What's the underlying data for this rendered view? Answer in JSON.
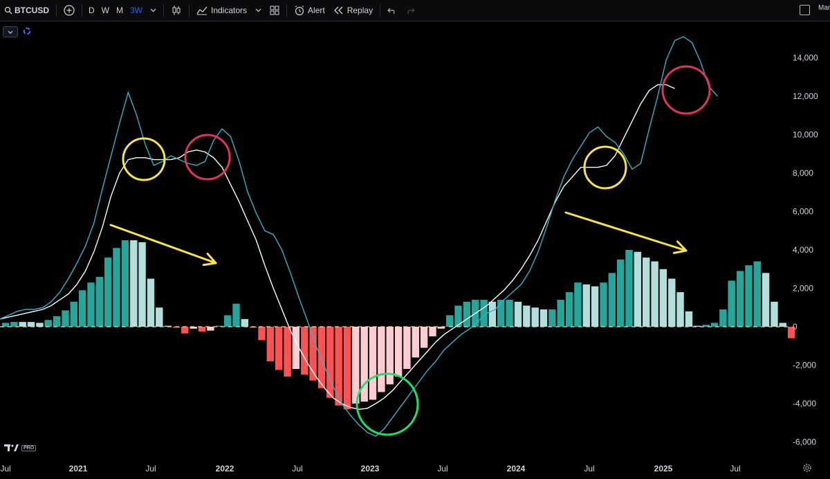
{
  "toolbar": {
    "symbol": "BTCUSD",
    "timeframes": [
      "D",
      "W",
      "M",
      "3W"
    ],
    "active_timeframe": "3W",
    "indicators_label": "Indicators",
    "alert_label": "Alert",
    "replay_label": "Replay",
    "right_label": "Mar"
  },
  "watermark": {
    "pro_label": "PRO"
  },
  "colors": {
    "macd_line": "#33b3c7",
    "signal_line": "#ffffff",
    "hist_pos_grow": "#26a69a",
    "hist_pos_fall": "#b2dfdb",
    "hist_neg_grow": "#ff5252",
    "hist_neg_fall": "#ffcdd2",
    "zero_line": "#f5e08a",
    "annotation_yellow": "#f7e34b",
    "annotation_red": "#e0335f",
    "annotation_green": "#1ee06a"
  },
  "chart_data": {
    "type": "bar",
    "x_ticks": [
      "Jul",
      "2021",
      "Jul",
      "2022",
      "Jul",
      "2023",
      "Jul",
      "2024",
      "Jul",
      "2025",
      "Jul"
    ],
    "y_ticks": [
      "14,000",
      "12,000",
      "10,000",
      "8,000",
      "6,000",
      "4,000",
      "2,000",
      "0",
      "-2,000",
      "-4,000",
      "-6,000"
    ],
    "ylim": [
      -6500,
      15500
    ],
    "histogram": [
      {
        "value": 200,
        "state": "grow"
      },
      {
        "value": 250,
        "state": "grow"
      },
      {
        "value": 250,
        "state": "fall"
      },
      {
        "value": 250,
        "state": "fall"
      },
      {
        "value": 200,
        "state": "fall"
      },
      {
        "value": 350,
        "state": "grow"
      },
      {
        "value": 550,
        "state": "grow"
      },
      {
        "value": 850,
        "state": "grow"
      },
      {
        "value": 1300,
        "state": "grow"
      },
      {
        "value": 1900,
        "state": "grow"
      },
      {
        "value": 2300,
        "state": "grow"
      },
      {
        "value": 2600,
        "state": "grow"
      },
      {
        "value": 3600,
        "state": "grow"
      },
      {
        "value": 4100,
        "state": "grow"
      },
      {
        "value": 4500,
        "state": "grow"
      },
      {
        "value": 4500,
        "state": "fall"
      },
      {
        "value": 4400,
        "state": "fall"
      },
      {
        "value": 2500,
        "state": "fall"
      },
      {
        "value": 1000,
        "state": "fall"
      },
      {
        "value": 50,
        "state": "fall"
      },
      {
        "value": -50,
        "state": "grow"
      },
      {
        "value": -350,
        "state": "grow"
      },
      {
        "value": -100,
        "state": "fall"
      },
      {
        "value": -250,
        "state": "grow"
      },
      {
        "value": -200,
        "state": "fall"
      },
      {
        "value": 50,
        "state": "grow"
      },
      {
        "value": 600,
        "state": "grow"
      },
      {
        "value": 1200,
        "state": "grow"
      },
      {
        "value": 400,
        "state": "fall"
      },
      {
        "value": -50,
        "state": "grow"
      },
      {
        "value": -700,
        "state": "grow"
      },
      {
        "value": -1800,
        "state": "grow"
      },
      {
        "value": -2250,
        "state": "grow"
      },
      {
        "value": -2600,
        "state": "grow"
      },
      {
        "value": -2200,
        "state": "fall"
      },
      {
        "value": -2500,
        "state": "grow"
      },
      {
        "value": -2800,
        "state": "grow"
      },
      {
        "value": -3200,
        "state": "grow"
      },
      {
        "value": -3700,
        "state": "grow"
      },
      {
        "value": -4100,
        "state": "grow"
      },
      {
        "value": -4300,
        "state": "grow"
      },
      {
        "value": -4000,
        "state": "fall"
      },
      {
        "value": -3900,
        "state": "fall"
      },
      {
        "value": -3800,
        "state": "fall"
      },
      {
        "value": -3400,
        "state": "fall"
      },
      {
        "value": -3000,
        "state": "fall"
      },
      {
        "value": -2600,
        "state": "fall"
      },
      {
        "value": -2200,
        "state": "fall"
      },
      {
        "value": -1600,
        "state": "fall"
      },
      {
        "value": -1100,
        "state": "fall"
      },
      {
        "value": -500,
        "state": "fall"
      },
      {
        "value": -100,
        "state": "fall"
      },
      {
        "value": 600,
        "state": "grow"
      },
      {
        "value": 1100,
        "state": "grow"
      },
      {
        "value": 1300,
        "state": "grow"
      },
      {
        "value": 1400,
        "state": "grow"
      },
      {
        "value": 1400,
        "state": "grow"
      },
      {
        "value": 1300,
        "state": "fall"
      },
      {
        "value": 1400,
        "state": "grow"
      },
      {
        "value": 1400,
        "state": "grow"
      },
      {
        "value": 1300,
        "state": "fall"
      },
      {
        "value": 1100,
        "state": "fall"
      },
      {
        "value": 1000,
        "state": "fall"
      },
      {
        "value": 900,
        "state": "fall"
      },
      {
        "value": 900,
        "state": "grow"
      },
      {
        "value": 1400,
        "state": "grow"
      },
      {
        "value": 1800,
        "state": "grow"
      },
      {
        "value": 2300,
        "state": "grow"
      },
      {
        "value": 2200,
        "state": "fall"
      },
      {
        "value": 2100,
        "state": "fall"
      },
      {
        "value": 2300,
        "state": "grow"
      },
      {
        "value": 2800,
        "state": "grow"
      },
      {
        "value": 3500,
        "state": "grow"
      },
      {
        "value": 4000,
        "state": "grow"
      },
      {
        "value": 3900,
        "state": "fall"
      },
      {
        "value": 3600,
        "state": "fall"
      },
      {
        "value": 3400,
        "state": "fall"
      },
      {
        "value": 3000,
        "state": "fall"
      },
      {
        "value": 2500,
        "state": "fall"
      },
      {
        "value": 1800,
        "state": "fall"
      },
      {
        "value": 800,
        "state": "fall"
      },
      {
        "value": 50,
        "state": "fall"
      },
      {
        "value": 100,
        "state": "grow"
      },
      {
        "value": 200,
        "state": "grow"
      },
      {
        "value": 900,
        "state": "grow"
      },
      {
        "value": 2400,
        "state": "grow"
      },
      {
        "value": 2900,
        "state": "grow"
      },
      {
        "value": 3200,
        "state": "grow"
      },
      {
        "value": 3400,
        "state": "grow"
      },
      {
        "value": 2800,
        "state": "fall"
      },
      {
        "value": 1300,
        "state": "fall"
      },
      {
        "value": 200,
        "state": "fall"
      },
      {
        "value": -600,
        "state": "grow"
      }
    ],
    "macd": [
      400,
      600,
      800,
      900,
      900,
      1000,
      1300,
      1800,
      2500,
      3300,
      4200,
      5400,
      7200,
      8900,
      10600,
      12200,
      11000,
      9500,
      8400,
      8600,
      8900,
      8700,
      8500,
      8400,
      8600,
      9700,
      10300,
      9900,
      8600,
      7000,
      5900,
      5000,
      4800,
      4000,
      2800,
      1500,
      300,
      -1000,
      -2100,
      -3100,
      -4000,
      -4600,
      -5100,
      -5500,
      -5700,
      -5300,
      -4700,
      -4100,
      -3500,
      -2900,
      -2300,
      -1800,
      -1200,
      -800,
      -400,
      -100,
      300,
      700,
      900,
      1400,
      1800,
      2200,
      2900,
      3900,
      5200,
      6600,
      7800,
      8700,
      9400,
      10100,
      10400,
      9900,
      9600,
      9000,
      8200,
      8500,
      10300,
      12000,
      13900,
      14900,
      15100,
      14800,
      13800,
      12500,
      12000
    ],
    "signal": [
      400,
      500,
      600,
      700,
      800,
      900,
      1100,
      1400,
      1700,
      2200,
      2900,
      3900,
      5200,
      6800,
      8000,
      8700,
      8800,
      8800,
      8700,
      8700,
      8700,
      8800,
      9100,
      9200,
      9100,
      8800,
      8300,
      7400,
      6500,
      5500,
      4500,
      3200,
      2000,
      900,
      -200,
      -1100,
      -1900,
      -2600,
      -3200,
      -3700,
      -4000,
      -4200,
      -4300,
      -4250,
      -4000,
      -3700,
      -3300,
      -2800,
      -2300,
      -1800,
      -1300,
      -800,
      -400,
      -100,
      200,
      500,
      800,
      1100,
      1500,
      1900,
      2400,
      3000,
      3700,
      4500,
      5500,
      6500,
      7300,
      7800,
      8300,
      8300,
      8300,
      8400,
      8900,
      9800,
      10700,
      11600,
      12300,
      12600,
      12600,
      12400
    ],
    "annotations": {
      "yellow_circles": 2,
      "red_circles": 2,
      "green_circles": 1,
      "yellow_arrows": 2
    }
  }
}
